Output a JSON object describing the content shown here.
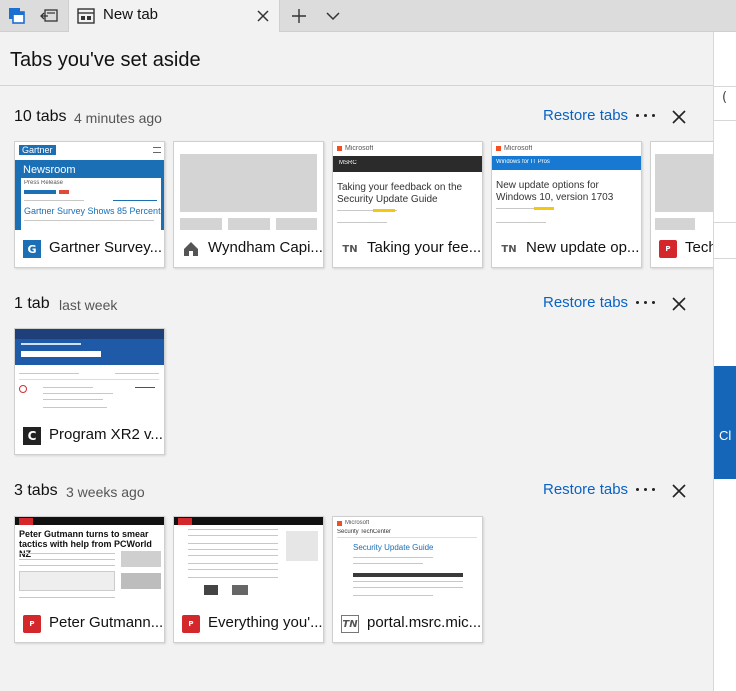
{
  "browser": {
    "active_tab": {
      "label": "New tab"
    }
  },
  "panel": {
    "title": "Tabs you've set aside"
  },
  "groups": [
    {
      "count": "10 tabs",
      "time": "4 minutes ago",
      "restore_label": "Restore tabs",
      "cards": [
        {
          "title": "Gartner Survey...",
          "thumb_logo": "Gartner",
          "thumb_heading": "Newsroom",
          "thumb_sub": "Press Release",
          "thumb_headline": "Gartner Survey Shows 85 Percent of"
        },
        {
          "title": "Wyndham Capi..."
        },
        {
          "title": "Taking your fee...",
          "thumb_brand": "Microsoft",
          "thumb_bar": "MSRC",
          "thumb_headline": "Taking your feedback on the Security Update Guide"
        },
        {
          "title": "New update op...",
          "thumb_brand": "Microsoft",
          "thumb_bar": "Windows for IT Pros",
          "thumb_headline": "New update options for Windows 10, version 1703"
        },
        {
          "title": "Techn..."
        }
      ]
    },
    {
      "count": "1 tab",
      "time": "last week",
      "restore_label": "Restore tabs",
      "cards": [
        {
          "title": "Program XR2 v..."
        }
      ]
    },
    {
      "count": "3 tabs",
      "time": "3 weeks ago",
      "restore_label": "Restore tabs",
      "cards": [
        {
          "title": "Peter Gutmann...",
          "thumb_headline": "Peter Gutmann turns to smear tactics with help from PCWorld NZ"
        },
        {
          "title": "Everything you'..."
        },
        {
          "title": "portal.msrc.mic...",
          "thumb_brand": "Microsoft",
          "thumb_bar": "Security TechCenter",
          "thumb_headline": "Security Update Guide"
        }
      ]
    }
  ],
  "favicon_labels": {
    "tn": "TN",
    "c": "C"
  },
  "colors": {
    "accent": "#0a63c4",
    "gartner_blue": "#1b6fb5",
    "pcworld_red": "#d3272b",
    "msrc_dark": "#2b2b2b",
    "windows_blue": "#1779d1",
    "bg_blue": "#1565b8"
  }
}
